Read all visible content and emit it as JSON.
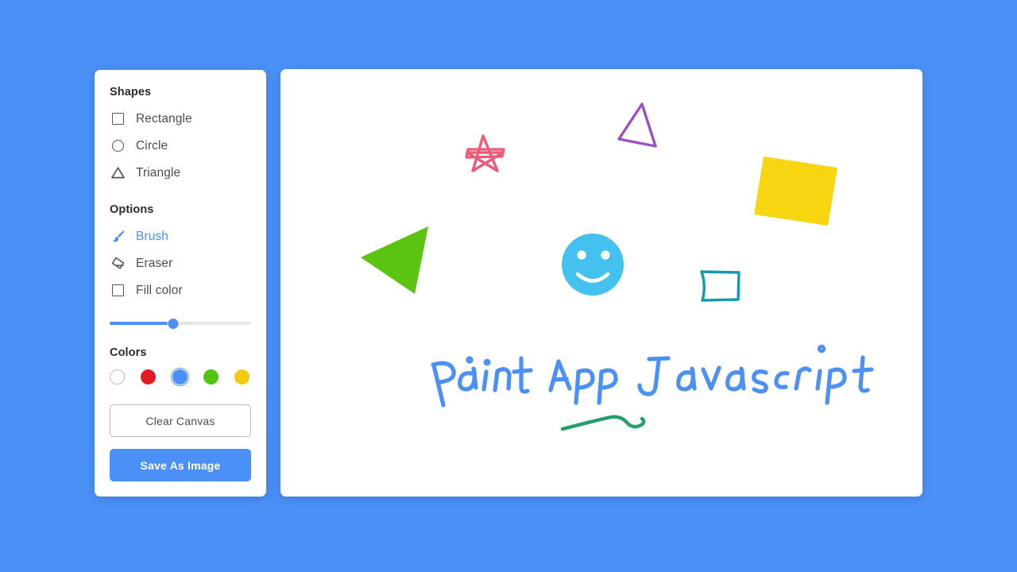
{
  "app": {
    "background_color": "#4a90f7",
    "panel_color": "#ffffff",
    "accent_color": "#4a90f7"
  },
  "toolbar": {
    "shapes_title": "Shapes",
    "shapes": [
      {
        "label": "Rectangle",
        "icon": "square-icon",
        "selected": false
      },
      {
        "label": "Circle",
        "icon": "circle-icon",
        "selected": false
      },
      {
        "label": "Triangle",
        "icon": "triangle-icon",
        "selected": false
      }
    ],
    "options_title": "Options",
    "options": [
      {
        "label": "Brush",
        "icon": "brush-icon",
        "selected": true
      },
      {
        "label": "Eraser",
        "icon": "eraser-icon",
        "selected": false
      },
      {
        "label": "Fill color",
        "icon": "checkbox-icon",
        "selected": false
      }
    ],
    "brush_size": {
      "value_percent": 45,
      "min": 0,
      "max": 100,
      "track_color": "#e6e6e6",
      "fill_color": "#4a90f7"
    },
    "colors_title": "Colors",
    "colors": [
      {
        "name": "white",
        "hex": "#ffffff",
        "selected": false,
        "outlined": true
      },
      {
        "name": "red",
        "hex": "#e01b24",
        "selected": false,
        "outlined": false
      },
      {
        "name": "blue",
        "hex": "#4a90f7",
        "selected": true,
        "outlined": false
      },
      {
        "name": "green",
        "hex": "#4fc510",
        "selected": false,
        "outlined": false
      },
      {
        "name": "yellow",
        "hex": "#f2ca12",
        "selected": false,
        "outlined": false
      }
    ],
    "clear_label": "Clear Canvas",
    "save_label": "Save As Image"
  },
  "canvas": {
    "handwritten_text": "Paint App Javascript",
    "handwriting_color": "#4a90f7",
    "drawings": [
      {
        "name": "star",
        "shape": "six-pointed-star",
        "color": "#ed5a78",
        "filled": false
      },
      {
        "name": "purple-triangle",
        "shape": "triangle",
        "color": "#9b4fc2",
        "filled": false
      },
      {
        "name": "yellow-rectangle",
        "shape": "rectangle",
        "color": "#f7d511",
        "filled": true
      },
      {
        "name": "green-triangle",
        "shape": "triangle",
        "color": "#5bc413",
        "filled": true
      },
      {
        "name": "smiley-face",
        "shape": "circle",
        "color": "#44c1ef",
        "filled": true
      },
      {
        "name": "teal-rectangle",
        "shape": "rectangle",
        "color": "#159aad",
        "filled": false
      },
      {
        "name": "green-squiggle",
        "shape": "freehand-stroke",
        "color": "#21a06a",
        "filled": false
      }
    ]
  }
}
